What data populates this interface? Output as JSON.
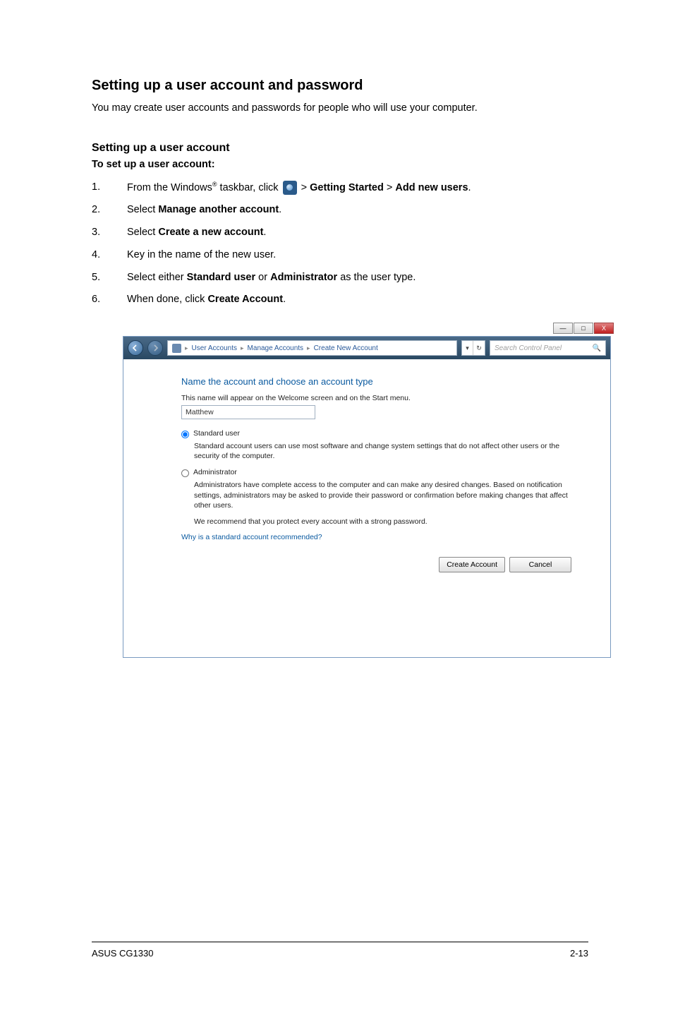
{
  "section_title": "Setting up a user account and password",
  "intro": "You may create user accounts and passwords for people who will use your computer.",
  "sub_title": "Setting up a user account",
  "bold_line": "To set up a user account:",
  "steps": [
    {
      "num": "1.",
      "pre": "From the Windows",
      "reg": "®",
      "after": " taskbar, click ",
      "strong1": "Getting Started",
      "gt": " > ",
      "strong2": "Add new users",
      "suffix": "."
    },
    {
      "num": "2.",
      "pre": "Select ",
      "strong1": "Manage another account",
      "suffix": "."
    },
    {
      "num": "3.",
      "pre": "Select ",
      "strong1": "Create a new account",
      "suffix": "."
    },
    {
      "num": "4.",
      "pre": "Key in the name of the new user."
    },
    {
      "num": "5.",
      "pre": "Select either ",
      "strong1": "Standard user",
      "mid": " or ",
      "strong2": "Administrator",
      "suffix": " as the user type."
    },
    {
      "num": "6.",
      "pre": "When done, click ",
      "strong1": "Create Account",
      "suffix": "."
    }
  ],
  "window": {
    "breadcrumb": {
      "seg1": "User Accounts",
      "seg2": "Manage Accounts",
      "seg3": "Create New Account"
    },
    "search_placeholder": "Search Control Panel",
    "heading": "Name the account and choose an account type",
    "sub": "This name will appear on the Welcome screen and on the Start menu.",
    "name_value": "Matthew",
    "radio1_label": "Standard user",
    "radio1_desc": "Standard account users can use most software and change system settings that do not affect other users or the security of the computer.",
    "radio2_label": "Administrator",
    "radio2_desc": "Administrators have complete access to the computer and can make any desired changes. Based on notification settings, administrators may be asked to provide their password or confirmation before making changes that affect other users.",
    "rec": "We recommend that you protect every account with a strong password.",
    "link": "Why is a standard account recommended?",
    "btn_create": "Create Account",
    "btn_cancel": "Cancel"
  },
  "footer": {
    "left": "ASUS CG1330",
    "right": "2-13"
  }
}
